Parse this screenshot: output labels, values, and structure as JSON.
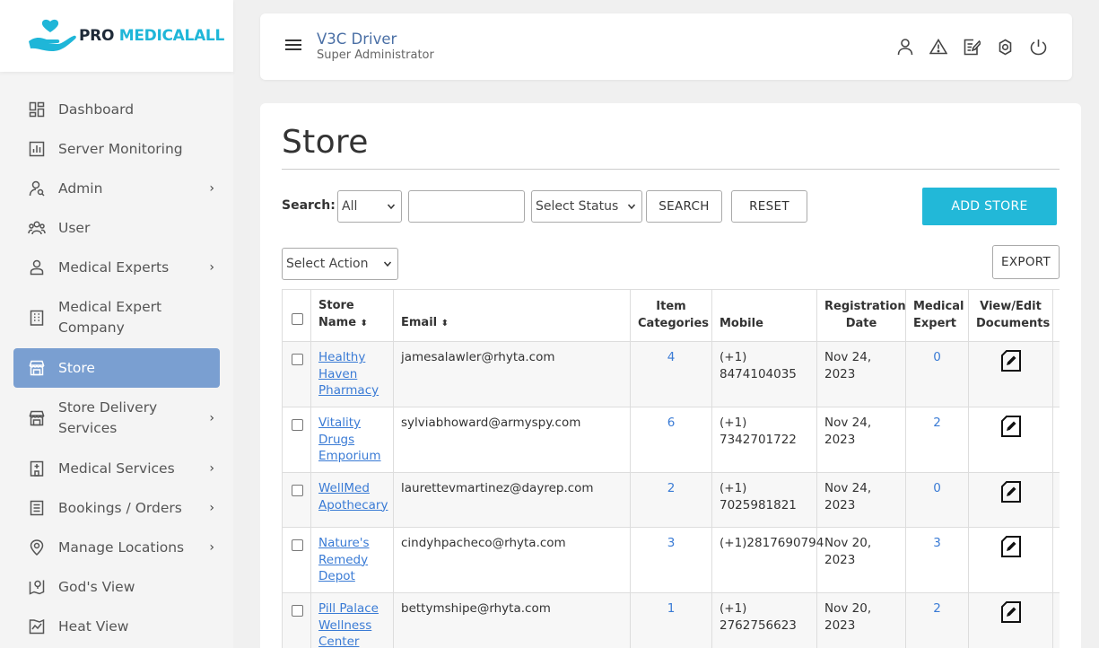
{
  "brand": {
    "part1": "PRO",
    "part2": "MEDICALALL"
  },
  "sidebar": {
    "items": [
      {
        "label": "Dashboard",
        "icon": "dashboard-icon",
        "chevron": false
      },
      {
        "label": "Server Monitoring",
        "icon": "bar-chart-icon",
        "chevron": false
      },
      {
        "label": "Admin",
        "icon": "admin-user-icon",
        "chevron": true
      },
      {
        "label": "User",
        "icon": "users-icon",
        "chevron": false
      },
      {
        "label": "Medical Experts",
        "icon": "person-icon",
        "chevron": true
      },
      {
        "label": "Medical Expert Company",
        "icon": "building-icon",
        "chevron": false
      },
      {
        "label": "Store",
        "icon": "store-icon",
        "chevron": false,
        "active": true
      },
      {
        "label": "Store Delivery Services",
        "icon": "store-delivery-icon",
        "chevron": true
      },
      {
        "label": "Medical Services",
        "icon": "hospital-icon",
        "chevron": true
      },
      {
        "label": "Bookings / Orders",
        "icon": "list-icon",
        "chevron": true
      },
      {
        "label": "Manage Locations",
        "icon": "location-pin-icon",
        "chevron": true
      },
      {
        "label": "God's View",
        "icon": "map-icon",
        "chevron": false
      },
      {
        "label": "Heat View",
        "icon": "heat-map-icon",
        "chevron": false
      }
    ]
  },
  "header": {
    "user_name": "V3C Driver",
    "user_role": "Super Administrator",
    "icons": [
      "profile-icon",
      "alert-icon",
      "edit-note-icon",
      "settings-icon",
      "power-icon"
    ]
  },
  "main": {
    "title": "Store",
    "search_label": "Search:",
    "search_field_select": "All",
    "search_input_value": "",
    "status_select": "Select Status",
    "search_button": "SEARCH",
    "reset_button": "RESET",
    "add_button": "ADD STORE",
    "action_select": "Select Action",
    "export_button": "EXPORT"
  },
  "table": {
    "headers": {
      "store_name": "Store Name",
      "email": "Email",
      "item_categories": "Item Categories",
      "mobile": "Mobile",
      "registration_date": "Registration Date",
      "medical_expert": "Medical Expert",
      "documents": "View/Edit Documents"
    },
    "rows": [
      {
        "store_name": "Healthy Haven Pharmacy",
        "email": "jamesalawler@rhyta.com",
        "item_categories": "4",
        "mobile": "(+1) 8474104035",
        "registration_date": "Nov 24, 2023",
        "medical_expert": "0"
      },
      {
        "store_name": "Vitality Drugs Emporium",
        "email": "sylviabhoward@armyspy.com",
        "item_categories": "6",
        "mobile": "(+1) 7342701722",
        "registration_date": "Nov 24, 2023",
        "medical_expert": "2"
      },
      {
        "store_name": "WellMed Apothecary",
        "email": "laurettevmartinez@dayrep.com",
        "item_categories": "2",
        "mobile": "(+1) 7025981821",
        "registration_date": "Nov 24, 2023",
        "medical_expert": "0"
      },
      {
        "store_name": "Nature's Remedy Depot",
        "email": "cindyhpacheco@rhyta.com",
        "item_categories": "3",
        "mobile": "(+1)2817690794",
        "registration_date": "Nov 20, 2023",
        "medical_expert": "3"
      },
      {
        "store_name": "Pill Palace Wellness Center",
        "email": "bettymshipe@rhyta.com",
        "item_categories": "1",
        "mobile": "(+1) 2762756623",
        "registration_date": "Nov 20, 2023",
        "medical_expert": "2"
      }
    ]
  },
  "colors": {
    "accent": "#22b8d8",
    "active_nav": "#7a9fd1",
    "link": "#3a7bd5"
  }
}
